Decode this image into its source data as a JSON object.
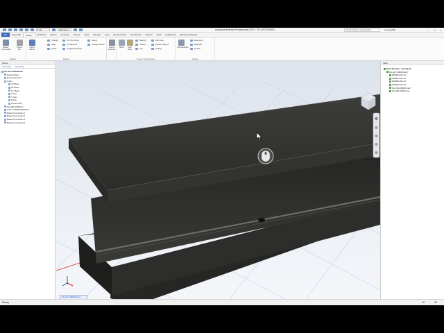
{
  "window": {
    "title": "Autodesk Inventor Professional 2023 · FG-AFY-000003",
    "doc_combo": "1:(4)",
    "material_combo": "Aluminum",
    "search_placeholder": "Search Help & Commands...",
    "user": "anurag1089"
  },
  "tabs": [
    "File",
    "Assemble",
    "Design",
    "3D Model",
    "Sketch",
    "Annotate",
    "Inspect",
    "Tools",
    "Manage",
    "View",
    "Environments",
    "Get Started",
    "Add-Ins",
    "Vault",
    "Collaborate",
    "Electromechanical"
  ],
  "active_tab": "Design",
  "ribbon": {
    "fasten_group": "Fasten",
    "frame_group": "Frame",
    "power_group": "Power Transmission",
    "spring_group": "Spring",
    "buttons": {
      "bolted": "Bolted Connection",
      "clevis": "Clevis Pin",
      "insert": "Insert Frame",
      "change": "Change",
      "miter": "Miter",
      "notch": "Notch",
      "trim_to_frame": "Trim To Frame",
      "trim_extend": "Trim/Extend",
      "lengthen": "Lengthen/Shorten",
      "reuse": "Reuse",
      "change_reuse": "Change Reuse",
      "frame_analysis": "Frame Analysis",
      "shaft": "Shaft",
      "spur": "Spur Gear",
      "bearing": "Bearing",
      "vbelts": "V-Belts",
      "key": "Key",
      "disc_cam": "Disc Cam",
      "parallel": "Parallel Splines",
      "oring": "O-Ring",
      "compression": "Compression",
      "extension": "Extension",
      "belleville": "Belleville",
      "torsion": "Torsion"
    }
  },
  "browser": {
    "header": "Model",
    "tabs": [
      "Assembly",
      "Modeling"
    ],
    "items": [
      "FG-AFY-000003.iam",
      "Relationships",
      "Representations",
      "Origin",
      "YZ Plane",
      "XZ Plane",
      "XY Plane",
      "X Axis",
      "Y Axis",
      "Z Axis",
      "Center Point",
      "FG-SR1-000001:1",
      "Frame 1000001000001:1",
      "Bolted Connection:1",
      "Bolted Connection:2",
      "Bolted Connection:3",
      "Bolted Connection:4"
    ]
  },
  "right_panel": {
    "header": "Vault",
    "items": [
      "Vault Designs - Hondaj.ipj",
      "FG-AFY-000003.iam*",
      "000000-Part.ipt*",
      "000001-Part.ipt*",
      "000002-Part.ipt*",
      "000003-Part.ipt*",
      "FG-FRA-000001.iam*",
      "FG-SRF-000001.ipt"
    ]
  },
  "viewport": {
    "doc_tab": "FG-AFY-000003.iam"
  },
  "status": {
    "text": "Ready",
    "count1": "42",
    "count2": "29"
  },
  "colors": {
    "file_tab": "#3a6cc2",
    "beam_dark": "#2e2e2c",
    "viewport_bg": "#eef1f6",
    "grid": "#c9d3e2"
  }
}
